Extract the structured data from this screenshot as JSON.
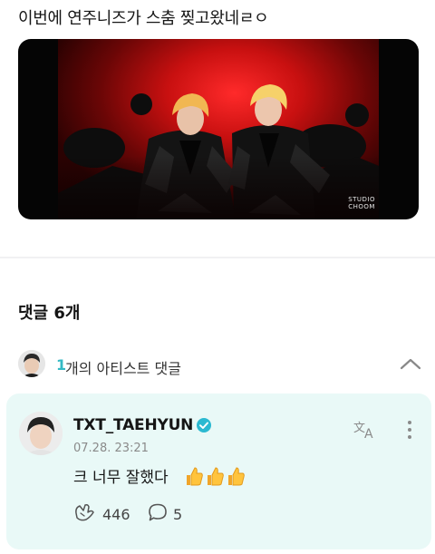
{
  "post": {
    "text": "이번에 연주니즈가 스춤 찢고왔네ㄹㅇ",
    "video": {
      "watermark_top": "STUDIO",
      "watermark_bottom": "CHOOM"
    }
  },
  "comments": {
    "title": "댓글 6개"
  },
  "artist_comments": {
    "count": "1",
    "label": "개의 아티스트 댓글",
    "collapse_icon": "chevron-up-icon"
  },
  "artist_comment": {
    "author": "TXT_TAEHYUN",
    "verified_icon": "verified-badge-icon",
    "date": "07.28. 23:21",
    "text": "크 너무 잘했다",
    "emoji": [
      "👍",
      "👍",
      "👍"
    ],
    "likes": "446",
    "replies": "5",
    "like_icon": "cheer-hands-icon",
    "reply_icon": "speech-bubble-icon",
    "translate_icon": "translate-icon",
    "more_icon": "more-vertical-icon"
  },
  "colors": {
    "accent": "#33b9c4",
    "card_bg": "#e9f9f7",
    "verified": "#2bb9d1"
  }
}
